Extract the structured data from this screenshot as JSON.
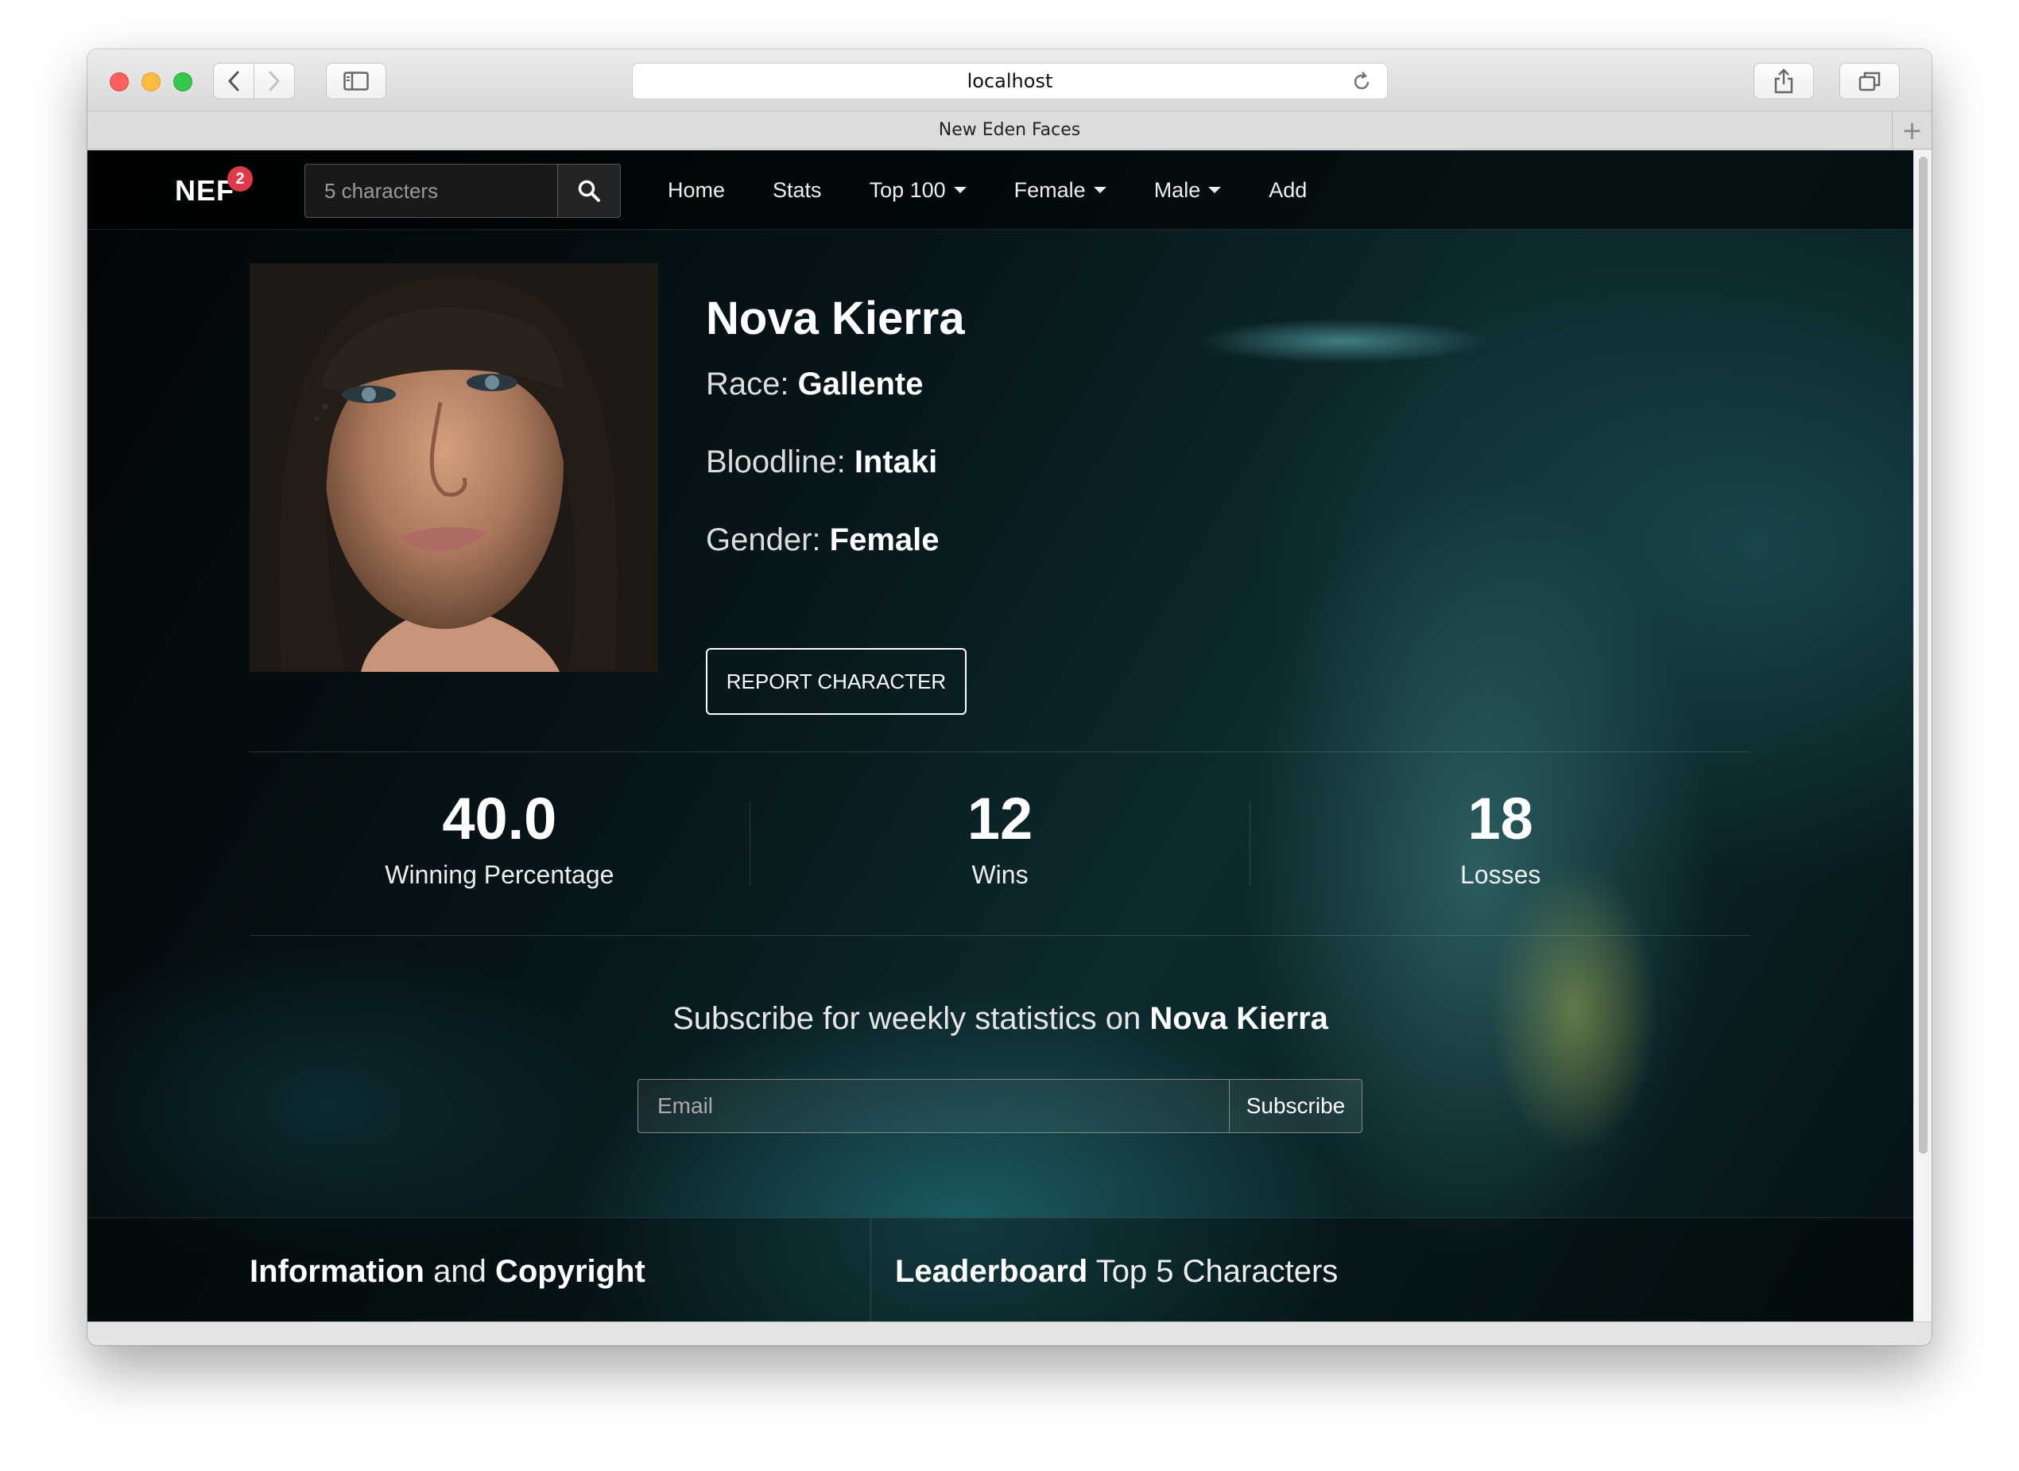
{
  "browser": {
    "address": "localhost",
    "tab_title": "New Eden Faces"
  },
  "navbar": {
    "brand": "NEF",
    "badge_count": "2",
    "search_placeholder": "5 characters",
    "links": [
      {
        "label": "Home"
      },
      {
        "label": "Stats"
      },
      {
        "label": "Top 100"
      },
      {
        "label": "Female"
      },
      {
        "label": "Male"
      },
      {
        "label": "Add"
      }
    ]
  },
  "character": {
    "name": "Nova Kierra",
    "race_label": "Race:",
    "race": "Gallente",
    "bloodline_label": "Bloodline:",
    "bloodline": "Intaki",
    "gender_label": "Gender:",
    "gender": "Female",
    "report_button": "REPORT CHARACTER"
  },
  "stats": [
    {
      "value": "40.0",
      "label": "Winning Percentage"
    },
    {
      "value": "12",
      "label": "Wins"
    },
    {
      "value": "18",
      "label": "Losses"
    }
  ],
  "subscribe": {
    "title_prefix": "Subscribe for weekly statistics on",
    "title_name": "Nova Kierra",
    "email_placeholder": "Email",
    "button": "Subscribe"
  },
  "footer": {
    "left_bold1": "Information",
    "left_mid": "and",
    "left_bold2": "Copyright",
    "right_bold": "Leaderboard",
    "right_rest": "Top 5 Characters"
  },
  "icons": {
    "search": "search-icon",
    "reload": "reload-icon",
    "share": "share-icon",
    "tabs": "tabs-icon",
    "sidebar": "sidebar-icon",
    "back": "chevron-left-icon",
    "forward": "chevron-right-icon",
    "new_tab": "plus-icon"
  }
}
